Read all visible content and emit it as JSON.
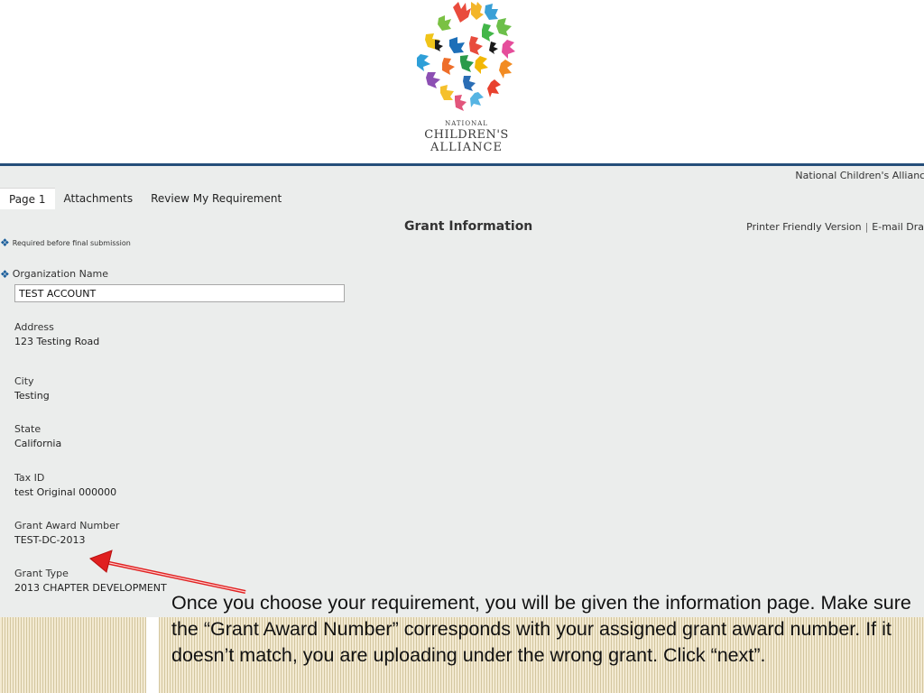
{
  "logo": {
    "line1": "NATIONAL",
    "line2": "CHILDREN'S",
    "line3": "ALLIANCE"
  },
  "header": {
    "org_name": "National Children's Alliance"
  },
  "tabs": [
    {
      "label": "Page 1",
      "active": true
    },
    {
      "label": "Attachments",
      "active": false
    },
    {
      "label": "Review My Requirement",
      "active": false
    }
  ],
  "page": {
    "title": "Grant Information",
    "printer_friendly": "Printer Friendly Version",
    "separator": "|",
    "email_draft": "E-mail Draft",
    "required_note": "Required before final submission"
  },
  "fields": {
    "organization_name": {
      "label": "Organization Name",
      "value": "TEST ACCOUNT"
    },
    "address": {
      "label": "Address",
      "value": "123 Testing Road"
    },
    "city": {
      "label": "City",
      "value": "Testing"
    },
    "state": {
      "label": "State",
      "value": "California"
    },
    "tax_id": {
      "label": "Tax ID",
      "value": "test Original 000000"
    },
    "grant_award_number": {
      "label": "Grant Award Number",
      "value": "TEST-DC-2013"
    },
    "grant_type": {
      "label": "Grant Type",
      "value": "2013 CHAPTER DEVELOPMENT"
    }
  },
  "callout": {
    "text": "Once you choose your requirement, you will be given the information page. Make sure the “Grant Award Number” corresponds with your assigned grant award number. If it doesn’t match, you are uploading under the wrong grant. Click “next”."
  },
  "colors": {
    "accent_blue": "#254e7a",
    "required_diamond": "#1c5f9c",
    "arrow_red": "#e02020",
    "panel_bg": "#ebedec"
  }
}
